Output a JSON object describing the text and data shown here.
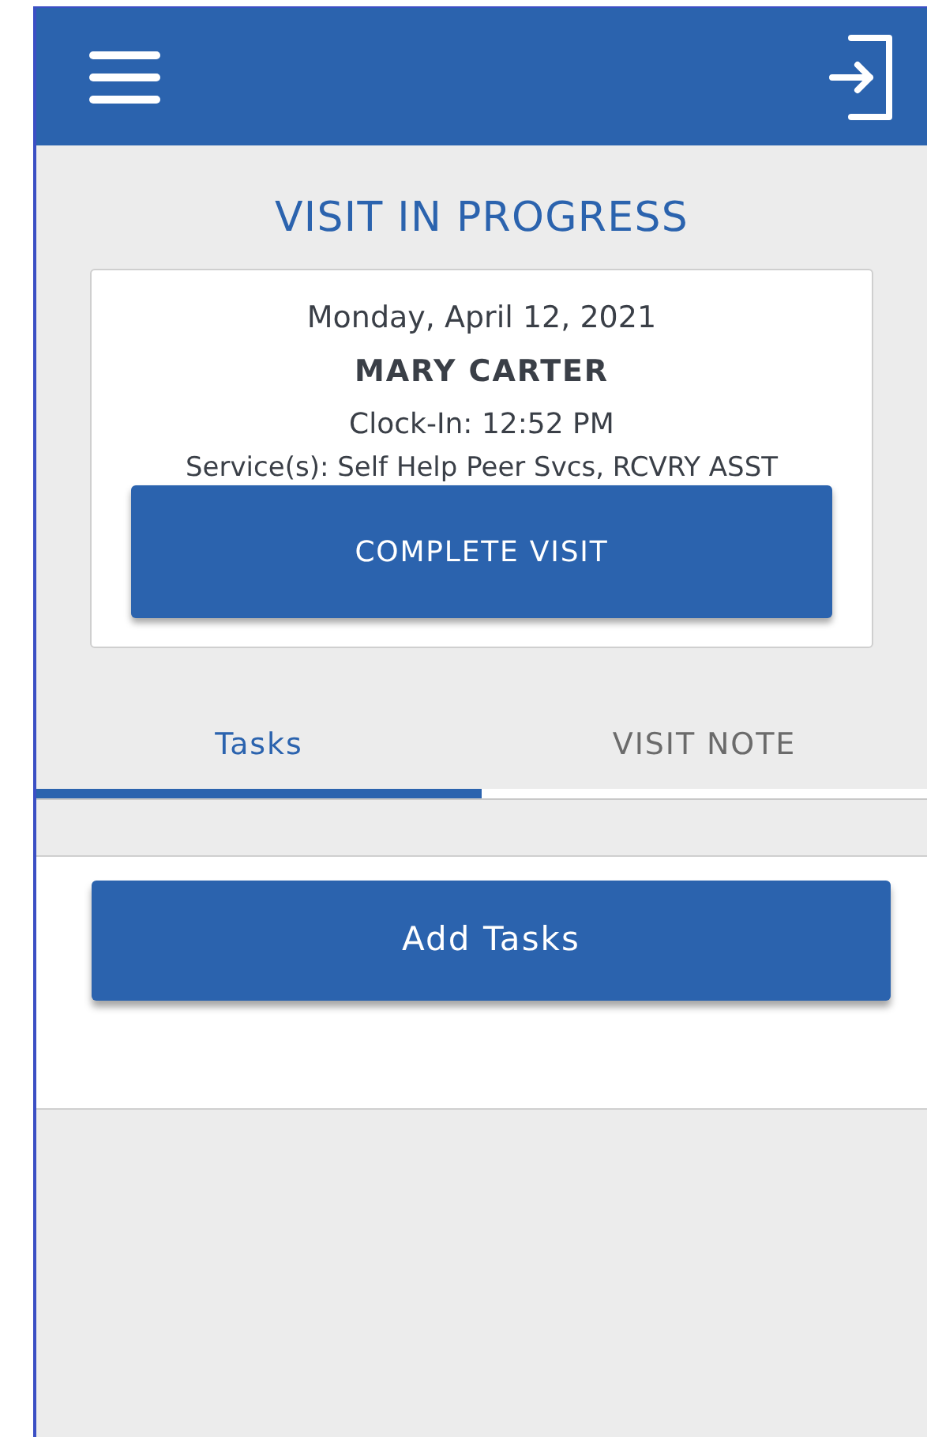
{
  "header": {
    "title": "VISIT IN PROGRESS"
  },
  "visit": {
    "date": "Monday, April 12, 2021",
    "client": "MARY CARTER",
    "clock_in": "Clock-In: 12:52 PM",
    "services": "Service(s): Self Help Peer Svcs, RCVRY ASST",
    "action": "COMPLETE VISIT"
  },
  "tabs": [
    {
      "label": "Tasks",
      "selected": true
    },
    {
      "label": "VISIT NOTE",
      "selected": false
    }
  ],
  "tasks_panel": {
    "button": "Add Tasks"
  }
}
